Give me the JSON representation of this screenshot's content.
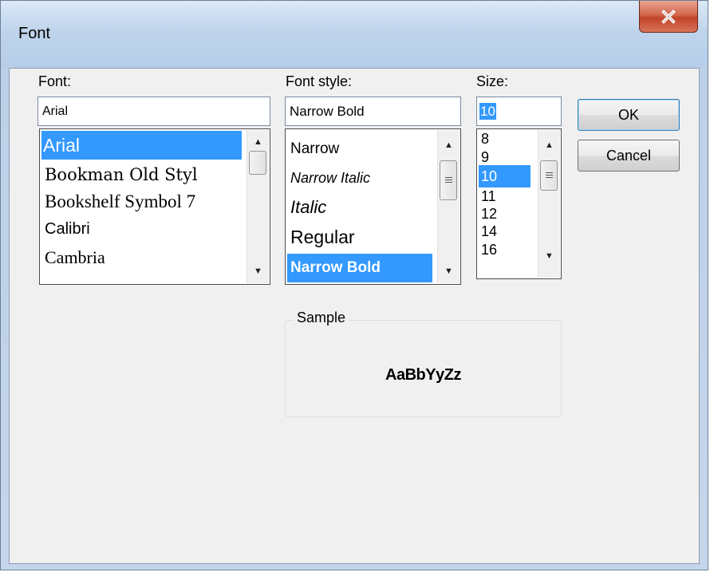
{
  "window": {
    "title": "Font",
    "close_label": "close"
  },
  "font": {
    "label": "Font:",
    "value": "Arial",
    "items": [
      "Arial",
      "Bookman Old Styl",
      "Bookshelf Symbol 7",
      "Calibri",
      "Cambria"
    ],
    "selected": "Arial"
  },
  "style": {
    "label": "Font style:",
    "value": "Narrow Bold",
    "items": [
      "Narrow",
      "Narrow Italic",
      "Italic",
      "Regular",
      "Narrow Bold"
    ],
    "selected": "Narrow Bold"
  },
  "size": {
    "label": "Size:",
    "value": "10",
    "items": [
      "8",
      "9",
      "10",
      "11",
      "12",
      "14",
      "16"
    ],
    "selected": "10"
  },
  "buttons": {
    "ok": "OK",
    "cancel": "Cancel"
  },
  "sample": {
    "caption": "Sample",
    "text": "AaBbYyZz"
  },
  "colors": {
    "selection": "#3399ff",
    "close_button": "#c1442a"
  }
}
